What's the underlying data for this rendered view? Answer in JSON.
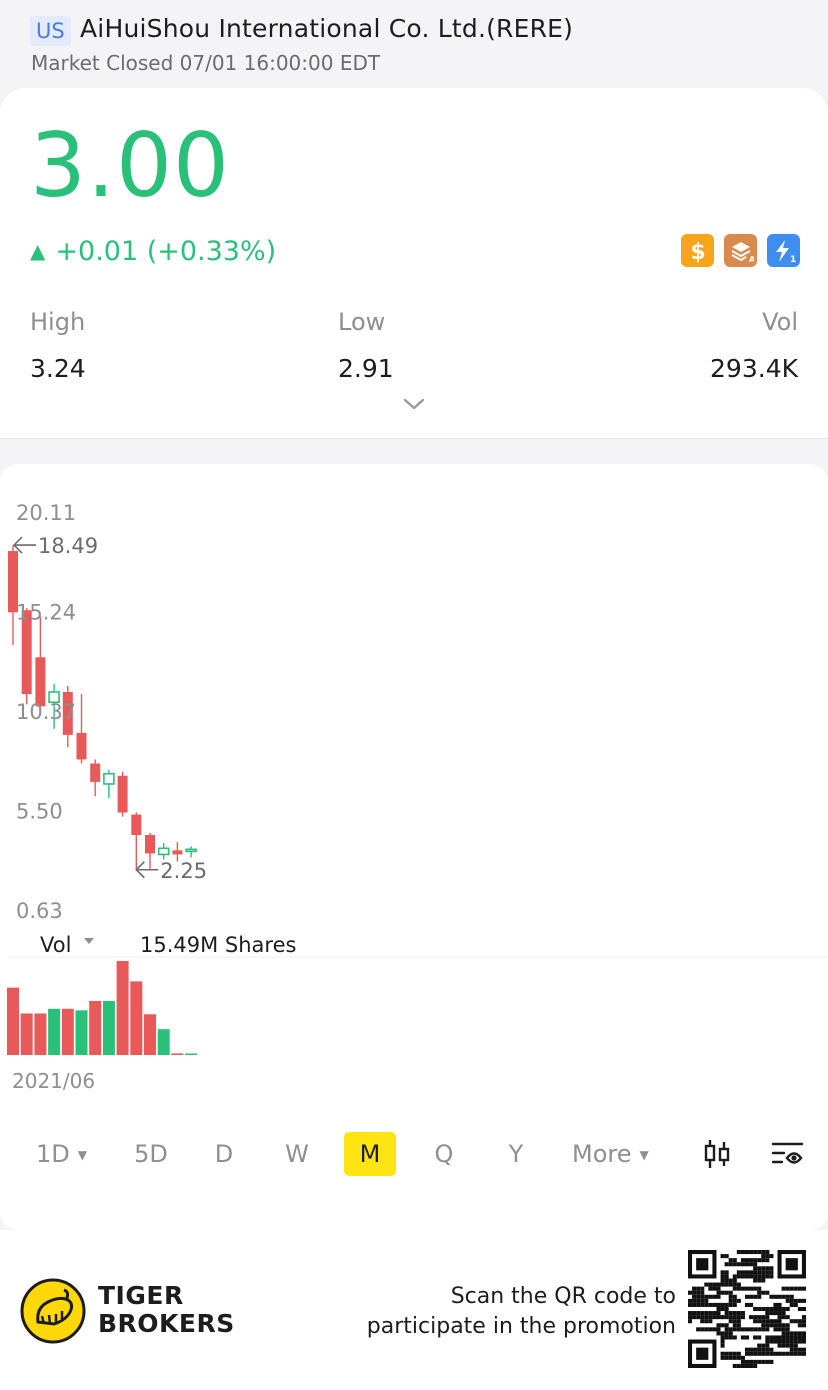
{
  "header": {
    "market": "US",
    "title": "AiHuiShou International Co. Ltd.(RERE)",
    "status": "Market Closed 07/01 16:00:00 EDT"
  },
  "quote": {
    "price": "3.00",
    "change": "+0.01 (+0.33%)",
    "direction": "up",
    "color_up": "#2ac07a",
    "stats": [
      {
        "label": "High",
        "value": "3.24"
      },
      {
        "label": "Low",
        "value": "2.91"
      },
      {
        "label": "Vol",
        "value": "293.4K"
      }
    ],
    "badge_icons": [
      "dollar-badge-icon",
      "stack-badge-icon",
      "lightning-badge-icon"
    ]
  },
  "chart": {
    "y_axis_labels": [
      "20.11",
      "15.24",
      "10.37",
      "5.50",
      "0.63"
    ],
    "max_marker": "18.49",
    "min_marker": "2.25",
    "volume_label": "Vol",
    "volume_value": "15.49M Shares",
    "x_start_label": "2021/06",
    "periods": [
      {
        "label": "1D",
        "dropdown": true
      },
      {
        "label": "5D"
      },
      {
        "label": "D"
      },
      {
        "label": "W"
      },
      {
        "label": "M",
        "active": true
      },
      {
        "label": "Q"
      },
      {
        "label": "Y"
      },
      {
        "label": "More",
        "dropdown": true
      }
    ],
    "tool_icons": [
      "candlestick-icon",
      "indicator-settings-icon"
    ],
    "colors": {
      "down": "#e85a5a",
      "up": "#2ac07a"
    }
  },
  "chart_data": {
    "type": "candlestick",
    "title": "",
    "interval": "monthly",
    "y_range": [
      0.63,
      20.11
    ],
    "candles": [
      {
        "open": 18.2,
        "close": 15.2,
        "high": 18.49,
        "low": 13.6
      },
      {
        "open": 15.3,
        "close": 11.2,
        "high": 15.4,
        "low": 10.7
      },
      {
        "open": 13.0,
        "close": 10.6,
        "high": 15.0,
        "low": 10.2
      },
      {
        "open": 10.8,
        "close": 11.3,
        "high": 11.7,
        "low": 9.5
      },
      {
        "open": 11.3,
        "close": 9.2,
        "high": 11.6,
        "low": 8.6
      },
      {
        "open": 9.3,
        "close": 8.0,
        "high": 11.2,
        "low": 7.8
      },
      {
        "open": 7.8,
        "close": 6.9,
        "high": 8.0,
        "low": 6.2
      },
      {
        "open": 6.8,
        "close": 7.3,
        "high": 7.5,
        "low": 6.1
      },
      {
        "open": 7.2,
        "close": 5.4,
        "high": 7.4,
        "low": 5.2
      },
      {
        "open": 5.3,
        "close": 4.3,
        "high": 5.4,
        "low": 2.6
      },
      {
        "open": 4.3,
        "close": 3.4,
        "high": 4.4,
        "low": 2.6
      },
      {
        "open": 3.35,
        "close": 3.65,
        "high": 3.9,
        "low": 3.1
      },
      {
        "open": 3.55,
        "close": 3.35,
        "high": 3.95,
        "low": 3.0
      },
      {
        "open": 3.5,
        "close": 3.6,
        "high": 3.75,
        "low": 3.2
      }
    ],
    "volume_shares_m": [
      8.6,
      5.3,
      5.3,
      5.9,
      5.9,
      5.7,
      6.9,
      6.9,
      12.0,
      9.4,
      5.2,
      3.3,
      0.2,
      0.1
    ],
    "volume_up": [
      false,
      false,
      false,
      true,
      false,
      true,
      false,
      true,
      false,
      false,
      false,
      true,
      false,
      true
    ]
  }
}
